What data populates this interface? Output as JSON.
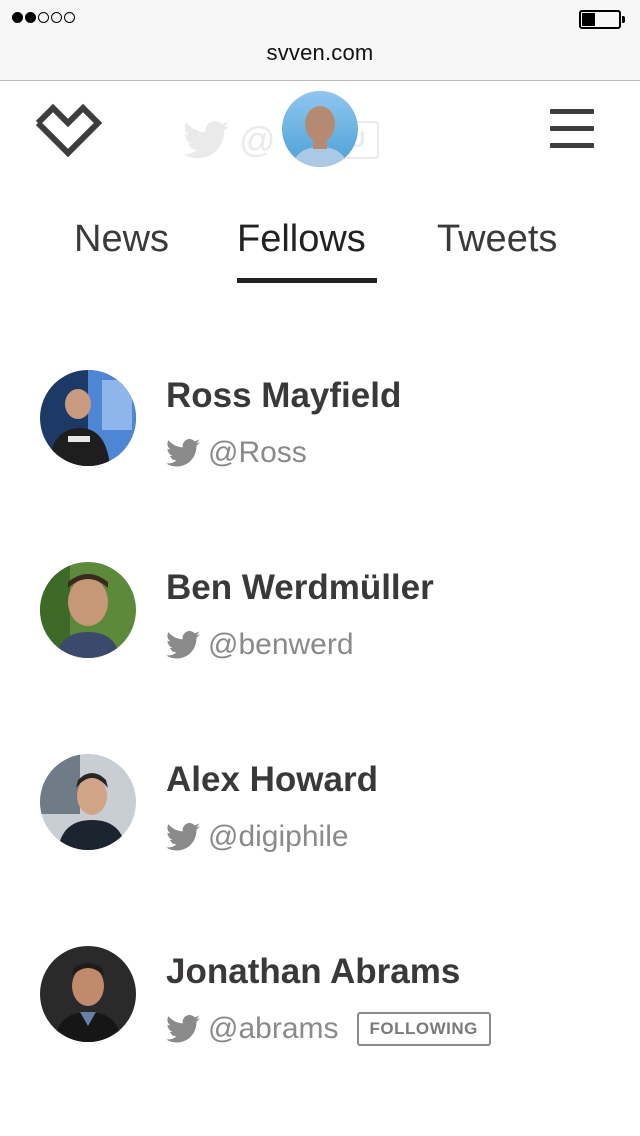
{
  "browser": {
    "url": "svven.com",
    "signal_icon": "signal-strength-icon",
    "battery_icon": "battery-icon"
  },
  "header": {
    "logo_icon": "heart-chevron-logo-icon",
    "ghost_handle": "@",
    "ghost_badge": "YOU",
    "menu_icon": "hamburger-menu-icon"
  },
  "tabs": [
    {
      "label": "News"
    },
    {
      "label": "Fellows"
    },
    {
      "label": "Tweets"
    }
  ],
  "fellows": [
    {
      "name": "Ross Mayfield",
      "handle": "@Ross"
    },
    {
      "name": "Ben Werdmüller",
      "handle": "@benwerd"
    },
    {
      "name": "Alex Howard",
      "handle": "@digiphile"
    },
    {
      "name": "Jonathan Abrams",
      "handle": "@abrams",
      "badge": "FOLLOWING"
    }
  ],
  "colors": {
    "text": "#3b3838",
    "handle": "#8a8a8a",
    "underline": "#222222"
  }
}
